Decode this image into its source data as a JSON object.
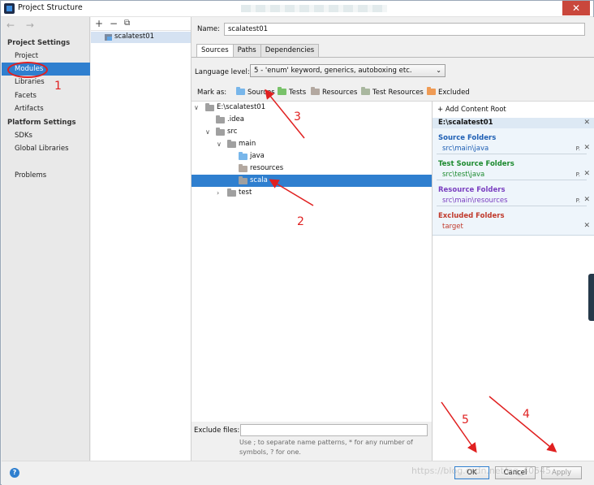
{
  "window": {
    "title": "Project Structure",
    "close_glyph": "✕"
  },
  "sidebar": {
    "nav_arrows": "← →",
    "project_settings_heading": "Project Settings",
    "project_items": [
      "Project",
      "Modules",
      "Libraries",
      "Facets",
      "Artifacts"
    ],
    "selected_item": "Modules",
    "platform_settings_heading": "Platform Settings",
    "platform_items": [
      "SDKs",
      "Global Libraries"
    ],
    "problems": "Problems"
  },
  "module_list": {
    "add": "+",
    "remove": "−",
    "copy": "⧉",
    "modules": [
      "scalatest01"
    ]
  },
  "module_settings": {
    "name_label": "Name:",
    "name_value": "scalatest01",
    "tabs": [
      "Sources",
      "Paths",
      "Dependencies"
    ],
    "active_tab": "Sources",
    "language_level_label": "Language level:",
    "language_level_value": "5 - 'enum' keyword, generics, autoboxing etc.",
    "mark_as_label": "Mark as:",
    "mark_as": [
      "Sources",
      "Tests",
      "Resources",
      "Test Resources",
      "Excluded"
    ]
  },
  "tree": {
    "root": "E:\\scalatest01",
    "idea": ".idea",
    "src": "src",
    "main": "main",
    "java": "java",
    "resources": "resources",
    "scala": "scala",
    "test": "test"
  },
  "content_roots": {
    "add_root": "Add Content Root",
    "root_path": "E:\\scalatest01",
    "sections": [
      {
        "title": "Source Folders",
        "path": "src\\main\\java",
        "color": "#1e5fb4"
      },
      {
        "title": "Test Source Folders",
        "path": "src\\test\\java",
        "color": "#1c8a2e"
      },
      {
        "title": "Resource Folders",
        "path": "src\\main\\resources",
        "color": "#7a3fc0"
      },
      {
        "title": "Excluded Folders",
        "path": "target",
        "color": "#c0392b"
      }
    ],
    "edit_glyph": "P."
  },
  "exclude": {
    "label": "Exclude files:",
    "value": "",
    "hint": "Use ; to separate name patterns, * for any number of symbols, ? for one."
  },
  "footer": {
    "help": "?",
    "ok": "OK",
    "cancel": "Cancel",
    "apply": "Apply",
    "watermark": "https://blog.csdn.net/qq_40545"
  },
  "annotations": [
    "1",
    "2",
    "3",
    "4",
    "5"
  ],
  "colors": {
    "selection": "#2f7fcf",
    "annotation": "#e02020"
  }
}
